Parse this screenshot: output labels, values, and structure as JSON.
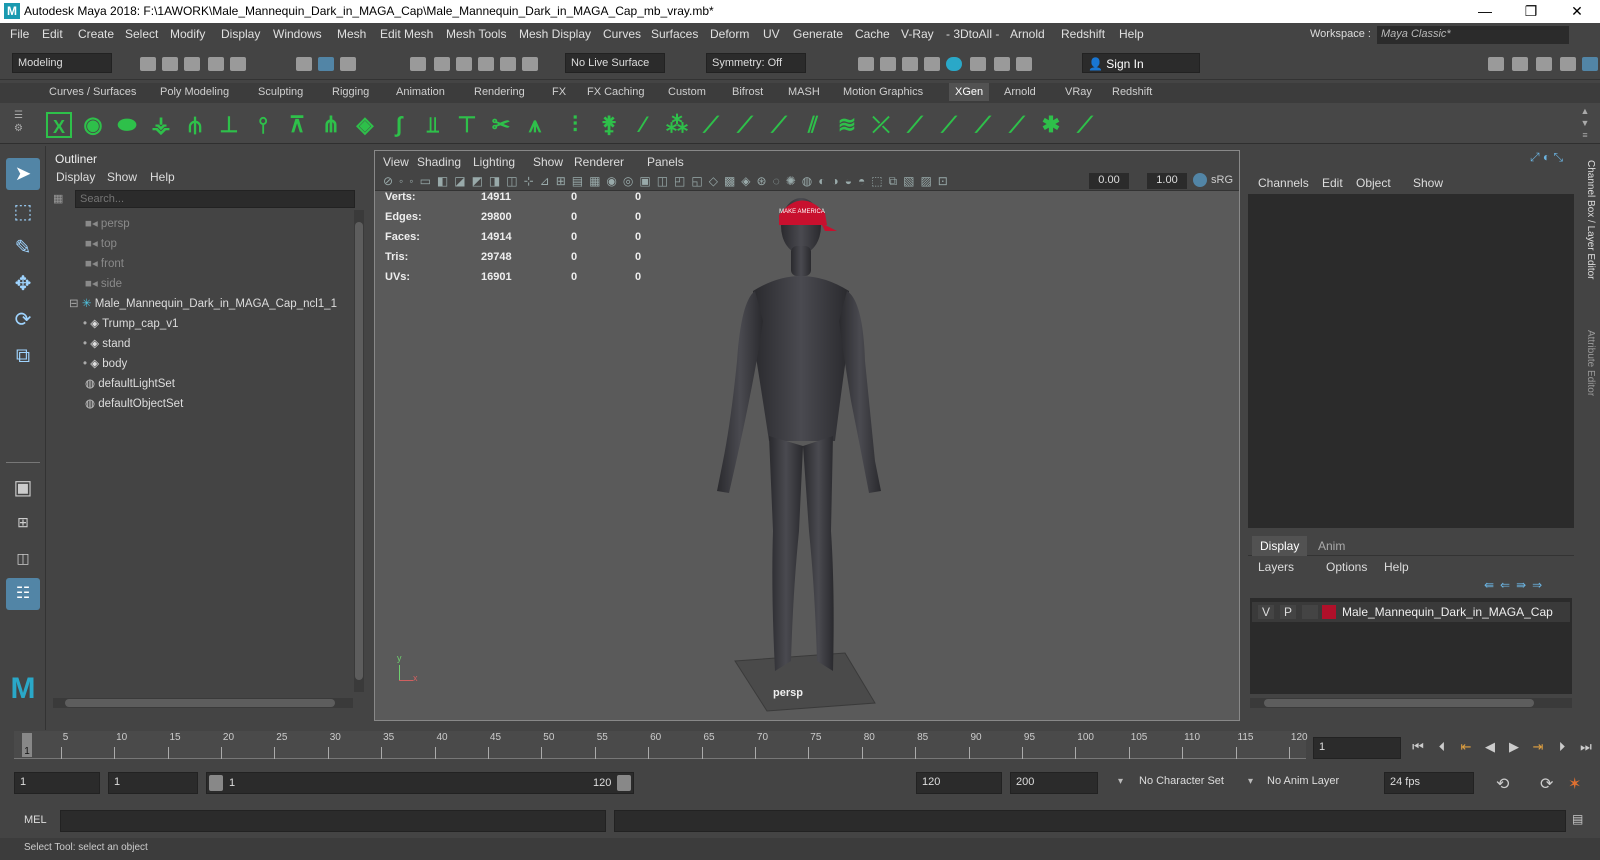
{
  "window": {
    "title": "Autodesk Maya 2018: F:\\1AWORK\\Male_Mannequin_Dark_in_MAGA_Cap\\Male_Mannequin_Dark_in_MAGA_Cap_mb_vray.mb*",
    "logo": "M",
    "minimize": "—",
    "restore": "❐",
    "close": "✕"
  },
  "menubar": {
    "items": [
      "File",
      "Edit",
      "Create",
      "Select",
      "Modify",
      "Display",
      "Windows",
      "Mesh",
      "Edit Mesh",
      "Mesh Tools",
      "Mesh Display",
      "Curves",
      "Surfaces",
      "Deform",
      "UV",
      "Generate",
      "Cache",
      "V-Ray",
      "- 3DtoAll -",
      "Arnold",
      "Redshift",
      "Help"
    ],
    "workspace_label": "Workspace :",
    "workspace_value": "Maya Classic*"
  },
  "statusline": {
    "mode": "Modeling",
    "live_surface": "No Live Surface",
    "symmetry": "Symmetry: Off",
    "sign_in": "Sign In"
  },
  "shelf": {
    "tabs": [
      "Curves / Surfaces",
      "Poly Modeling",
      "Sculpting",
      "Rigging",
      "Animation",
      "Rendering",
      "FX",
      "FX Caching",
      "Custom",
      "Bifrost",
      "MASH",
      "Motion Graphics",
      "XGen",
      "Arnold",
      "VRay",
      "Redshift"
    ],
    "active_tab": "XGen"
  },
  "outliner": {
    "title": "Outliner",
    "menu": [
      "Display",
      "Show",
      "Help"
    ],
    "search_placeholder": "Search...",
    "items": [
      {
        "label": "persp",
        "kind": "camera"
      },
      {
        "label": "top",
        "kind": "camera"
      },
      {
        "label": "front",
        "kind": "camera"
      },
      {
        "label": "side",
        "kind": "camera"
      },
      {
        "label": "Male_Mannequin_Dark_in_MAGA_Cap_ncl1_1",
        "kind": "group"
      },
      {
        "label": "Trump_cap_v1",
        "kind": "mesh"
      },
      {
        "label": "stand",
        "kind": "mesh"
      },
      {
        "label": "body",
        "kind": "mesh"
      },
      {
        "label": "defaultLightSet",
        "kind": "set"
      },
      {
        "label": "defaultObjectSet",
        "kind": "set"
      }
    ]
  },
  "viewport": {
    "menu": [
      "View",
      "Shading",
      "Lighting",
      "Show",
      "Renderer",
      "Panels"
    ],
    "exposure": "0.00",
    "gamma": "1.00",
    "colorspace": "sRG",
    "camera_label": "persp",
    "cap_text": "MAKE AMERICA",
    "hud": [
      {
        "label": "Verts:",
        "v1": "14911",
        "v2": "0",
        "v3": "0"
      },
      {
        "label": "Edges:",
        "v1": "29800",
        "v2": "0",
        "v3": "0"
      },
      {
        "label": "Faces:",
        "v1": "14914",
        "v2": "0",
        "v3": "0"
      },
      {
        "label": "Tris:",
        "v1": "29748",
        "v2": "0",
        "v3": "0"
      },
      {
        "label": "UVs:",
        "v1": "16901",
        "v2": "0",
        "v3": "0"
      }
    ],
    "axis_y": "y",
    "axis_x": "x"
  },
  "channelbox": {
    "menu": [
      "Channels",
      "Edit",
      "Object",
      "Show"
    ],
    "side_tab_1": "Channel Box / Layer Editor",
    "side_tab_2": "Attribute Editor",
    "layer_tabs": [
      "Display",
      "Anim"
    ],
    "layer_menu": [
      "Layers",
      "Options",
      "Help"
    ],
    "layer": {
      "v": "V",
      "p": "P",
      "name": "Male_Mannequin_Dark_in_MAGA_Cap",
      "color": "#b0102a"
    }
  },
  "timeline": {
    "ticks": [
      "5",
      "10",
      "15",
      "20",
      "25",
      "30",
      "35",
      "40",
      "45",
      "50",
      "55",
      "60",
      "65",
      "70",
      "75",
      "80",
      "85",
      "90",
      "95",
      "100",
      "105",
      "110",
      "115",
      "120"
    ],
    "current_marker": "1",
    "current_frame": "1"
  },
  "range": {
    "start": "1",
    "playback_start": "1",
    "slider_start": "1",
    "slider_end": "120",
    "playback_end": "120",
    "end": "200",
    "character_set": "No Character Set",
    "anim_layer": "No Anim Layer",
    "fps": "24 fps"
  },
  "cmd": {
    "mel": "MEL"
  },
  "help": {
    "text": "Select Tool: select an object"
  },
  "colors": {
    "accent_green": "#2ec04a",
    "selected_blue": "#5285a6",
    "cap_red": "#c8102e"
  }
}
